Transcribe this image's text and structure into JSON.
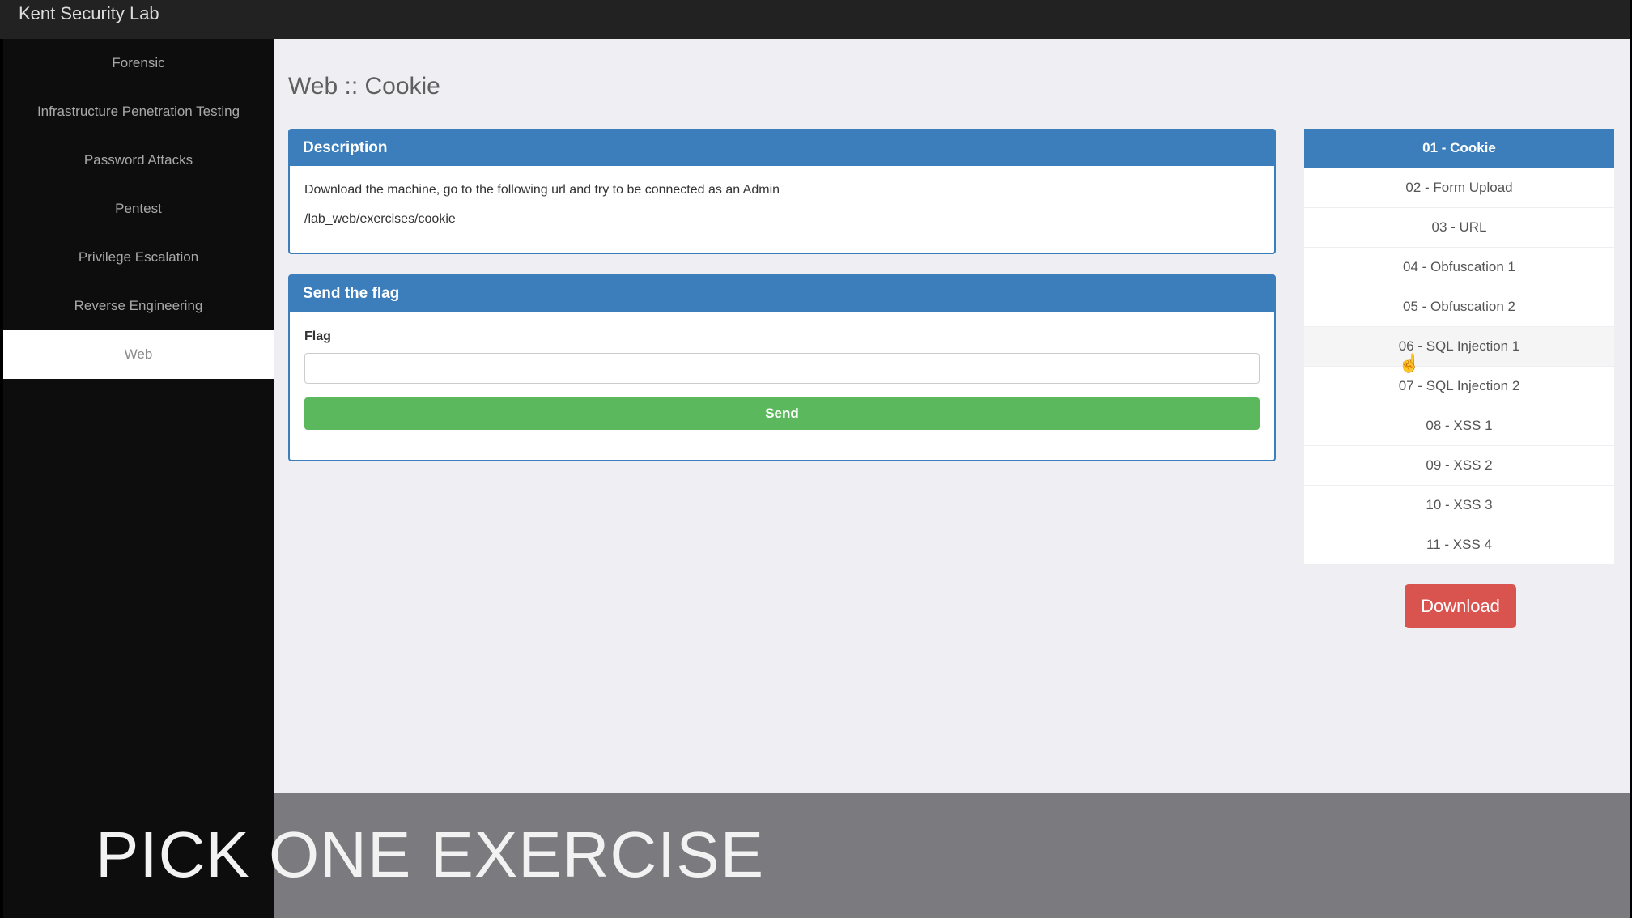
{
  "app": {
    "title": "Kent Security Lab"
  },
  "sidebar": {
    "items": [
      {
        "label": "Forensic",
        "active": false
      },
      {
        "label": "Infrastructure Penetration Testing",
        "active": false
      },
      {
        "label": "Password Attacks",
        "active": false
      },
      {
        "label": "Pentest",
        "active": false
      },
      {
        "label": "Privilege Escalation",
        "active": false
      },
      {
        "label": "Reverse Engineering",
        "active": false
      },
      {
        "label": "Web",
        "active": true
      }
    ]
  },
  "main": {
    "title": "Web :: Cookie",
    "description": {
      "heading": "Description",
      "text": "Download the machine, go to the following url and try to be connected as an Admin",
      "url": "/lab_web/exercises/cookie"
    },
    "flag_form": {
      "heading": "Send the flag",
      "label": "Flag",
      "value": "",
      "button": "Send"
    }
  },
  "exercises": {
    "items": [
      {
        "label": "01 - Cookie",
        "active": true
      },
      {
        "label": "02 - Form Upload"
      },
      {
        "label": "03 - URL"
      },
      {
        "label": "04 - Obfuscation 1"
      },
      {
        "label": "05 - Obfuscation 2"
      },
      {
        "label": "06 - SQL Injection 1",
        "hover": true
      },
      {
        "label": "07 - SQL Injection 2"
      },
      {
        "label": "08 - XSS 1"
      },
      {
        "label": "09 - XSS 2"
      },
      {
        "label": "10 - XSS 3"
      },
      {
        "label": "11 - XSS 4"
      }
    ],
    "download_button": "Download"
  },
  "caption": "PICK ONE EXERCISE",
  "colors": {
    "primary": "#3b7ebb",
    "success": "#5cb85c",
    "danger": "#d9534f",
    "sidebar_bg": "#0d0d0d",
    "topbar_bg": "#222222"
  },
  "icons": {
    "cursor": "hand-pointer-icon"
  }
}
